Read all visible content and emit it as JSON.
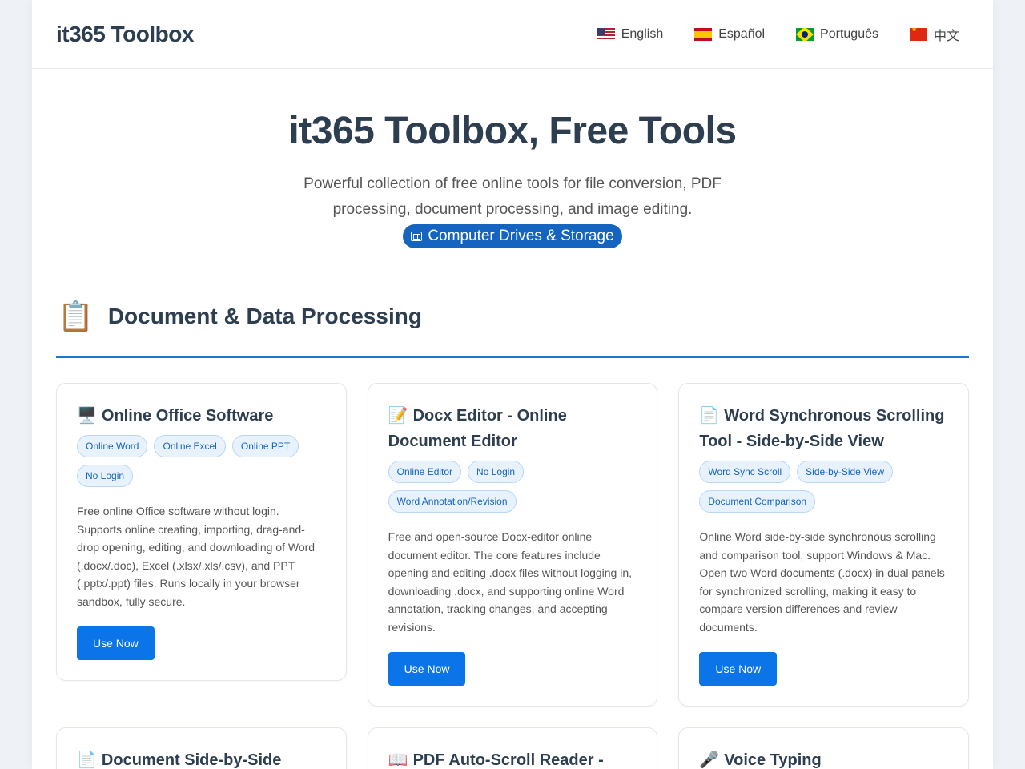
{
  "header": {
    "logo": "it365 Toolbox",
    "languages": [
      {
        "label": "English",
        "flag": "us-flag-icon"
      },
      {
        "label": "Español",
        "flag": "spain-flag-icon"
      },
      {
        "label": "Português",
        "flag": "brazil-flag-icon"
      },
      {
        "label": "中文",
        "flag": "china-flag-icon"
      }
    ]
  },
  "hero": {
    "title": "it365 Toolbox, Free Tools",
    "subtitle": "Powerful collection of free online tools for file conversion, PDF processing, document processing, and image editing.",
    "pill_label": "Computer Drives & Storage"
  },
  "section": {
    "icon": "📋",
    "title": "Document & Data Processing",
    "accent_color": "#1976d2"
  },
  "cards": [
    {
      "icon": "🖥️",
      "title": "Online Office Software",
      "tags": [
        "Online Word",
        "Online Excel",
        "Online PPT",
        "No Login"
      ],
      "description": "Free online Office software without login. Supports online creating, importing, drag-and-drop opening, editing, and downloading of Word (.docx/.doc), Excel (.xlsx/.xls/.csv), and PPT (.pptx/.ppt) files. Runs locally in your browser sandbox, fully secure.",
      "button": "Use Now"
    },
    {
      "icon": "📝",
      "title": "Docx Editor - Online Document Editor",
      "tags": [
        "Online Editor",
        "No Login",
        "Word Annotation/Revision"
      ],
      "description": "Free and open-source Docx-editor online document editor. The core features include opening and editing .docx files without logging in, downloading .docx, and supporting online Word annotation, tracking changes, and accepting revisions.",
      "button": "Use Now"
    },
    {
      "icon": "📄",
      "title": "Word Synchronous Scrolling Tool - Side-by-Side View",
      "tags": [
        "Word Sync Scroll",
        "Side-by-Side View",
        "Document Comparison"
      ],
      "description": "Online Word side-by-side synchronous scrolling and comparison tool, support Windows & Mac. Open two Word documents (.docx) in dual panels for synchronized scrolling, making it easy to compare version differences and review documents.",
      "button": "Use Now"
    }
  ],
  "cards_row2": [
    {
      "icon": "📄",
      "title": "Document Side-by-Side"
    },
    {
      "icon": "📖",
      "title": "PDF Auto-Scroll Reader -"
    },
    {
      "icon": "🎤",
      "title": "Voice Typing"
    }
  ],
  "colors": {
    "button": "#0a74e8",
    "tag_bg": "#e8f2fd",
    "tag_text": "#1565c0",
    "pill_bg": "#1565c0"
  }
}
